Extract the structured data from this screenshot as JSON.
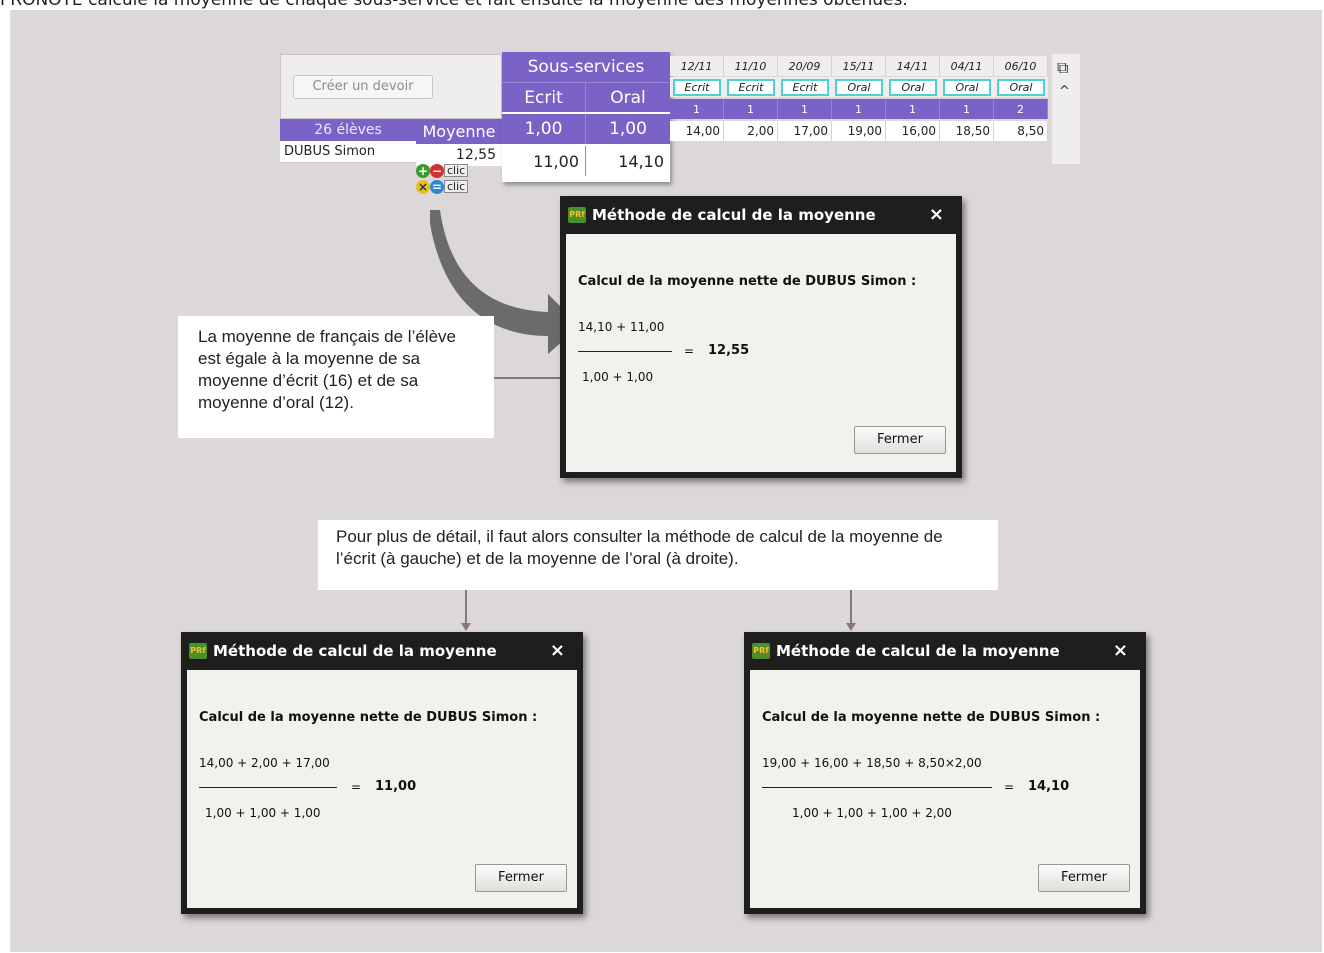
{
  "intro_text": "PRONOTE calcule la moyenne de chaque sous-service et fait ensuite la moyenne des moyennes obtenues.",
  "grid": {
    "create_button": "Créer un devoir",
    "student_count": "26 élèves",
    "average_header": "Moyenne",
    "student_name": "DUBUS Simon",
    "student_average": "12,55",
    "subservices": {
      "title": "Sous-services",
      "columns": [
        "Ecrit",
        "Oral"
      ],
      "coefs": [
        "1,00",
        "1,00"
      ],
      "values": [
        "11,00",
        "14,10"
      ]
    },
    "assignments": {
      "dates": [
        "12/11",
        "11/10",
        "20/09",
        "15/11",
        "14/11",
        "04/11",
        "06/10"
      ],
      "types": [
        "Ecrit",
        "Ecrit",
        "Ecrit",
        "Oral",
        "Oral",
        "Oral",
        "Oral"
      ],
      "coefs": [
        "1",
        "1",
        "1",
        "1",
        "1",
        "1",
        "2"
      ],
      "marks": [
        "14,00",
        "2,00",
        "17,00",
        "19,00",
        "16,00",
        "18,50",
        "8,50"
      ]
    },
    "clic_label": "clic"
  },
  "dialogs": {
    "main": {
      "title": "Méthode de calcul de la moyenne",
      "heading": "Calcul de la moyenne nette de DUBUS Simon :",
      "numerator": "14,10 + 11,00",
      "denominator": "1,00 + 1,00",
      "equals": "=",
      "result": "12,55",
      "close_button": "Fermer"
    },
    "ecrit": {
      "title": "Méthode de calcul de la moyenne",
      "heading": "Calcul de la moyenne nette de DUBUS Simon :",
      "numerator": "14,00 + 2,00 + 17,00",
      "denominator": "1,00 + 1,00 + 1,00",
      "equals": "=",
      "result": "11,00",
      "close_button": "Fermer"
    },
    "oral": {
      "title": "Méthode de calcul de la moyenne",
      "heading": "Calcul de la moyenne nette de DUBUS Simon :",
      "numerator": "19,00 + 16,00 + 18,50 + 8,50×2,00",
      "denominator": "1,00 + 1,00 + 1,00 + 2,00",
      "equals": "=",
      "result": "14,10",
      "close_button": "Fermer"
    }
  },
  "callouts": {
    "french_average": "La moyenne de français de l’élève est égale à la moyenne de sa moyenne d’écrit (16) et de sa moyenne d’oral (12).",
    "more_detail": "Pour plus de détail, il faut alors consulter la méthode de calcul de la moyenne de l’écrit (à gauche) et de la moyenne de l’oral (à droite)."
  },
  "icons": {
    "app_logo_text": "PRf",
    "close": "×",
    "copy": "⧉",
    "scroll_up": "^"
  },
  "colors": {
    "panel_bg": "#dcd8d9",
    "header_purple": "#7b62c6",
    "type_border_cyan": "#4fd0d8",
    "dialog_frame": "#1e1e1e",
    "dialog_body": "#f3f1ee",
    "connector": "#8a7676"
  }
}
